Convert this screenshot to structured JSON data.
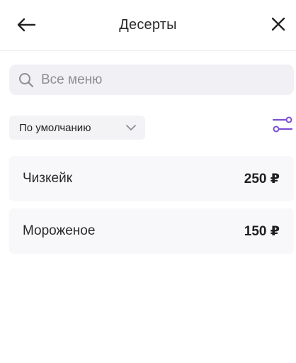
{
  "header": {
    "title": "Десерты",
    "back_icon": "arrow-left-icon",
    "close_icon": "close-icon"
  },
  "search": {
    "placeholder": "Все меню",
    "icon": "search-icon"
  },
  "sort": {
    "selected": "По умолчанию",
    "icon": "chevron-down-icon"
  },
  "filter": {
    "icon": "filter-sliders-icon",
    "accent_color": "#7b4fd6"
  },
  "items": [
    {
      "name": "Чизкейк",
      "price": "250 ₽"
    },
    {
      "name": "Мороженое",
      "price": "150 ₽"
    }
  ]
}
